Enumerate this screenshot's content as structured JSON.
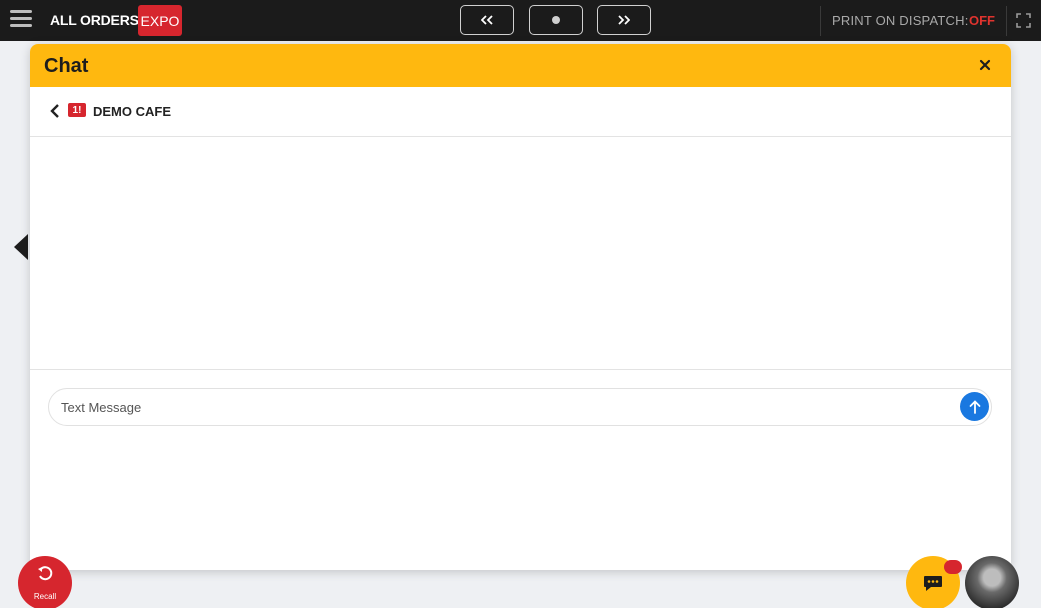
{
  "topbar": {
    "brand": "ALL ORDERS",
    "mode_badge": "EXPO",
    "print_on_dispatch_label": "PRINT ON DISPATCH:",
    "print_on_dispatch_value": "OFF",
    "colors": {
      "background": "#1b1b1b",
      "badge": "#d6262e",
      "off": "#e0332e"
    }
  },
  "icons": {
    "menu": "hamburger-menu-icon",
    "prev": "double-chevron-left-icon",
    "current": "dot-icon",
    "next": "double-chevron-right-icon",
    "fullscreen": "fullscreen-icon",
    "side_arrow": "triangle-left-icon",
    "close": "close-icon",
    "back": "chevron-left-icon",
    "send": "arrow-up-icon",
    "recall": "undo-icon",
    "chat": "chat-bubble-icon"
  },
  "chat": {
    "title": "Chat",
    "conversation": {
      "logo_text": "1!",
      "name": "DEMO CAFE"
    },
    "compose": {
      "placeholder": "Text Message",
      "value": ""
    },
    "colors": {
      "header": "#ffb80f",
      "send": "#1a78e0"
    }
  },
  "bottom": {
    "recall_label": "Recall"
  }
}
